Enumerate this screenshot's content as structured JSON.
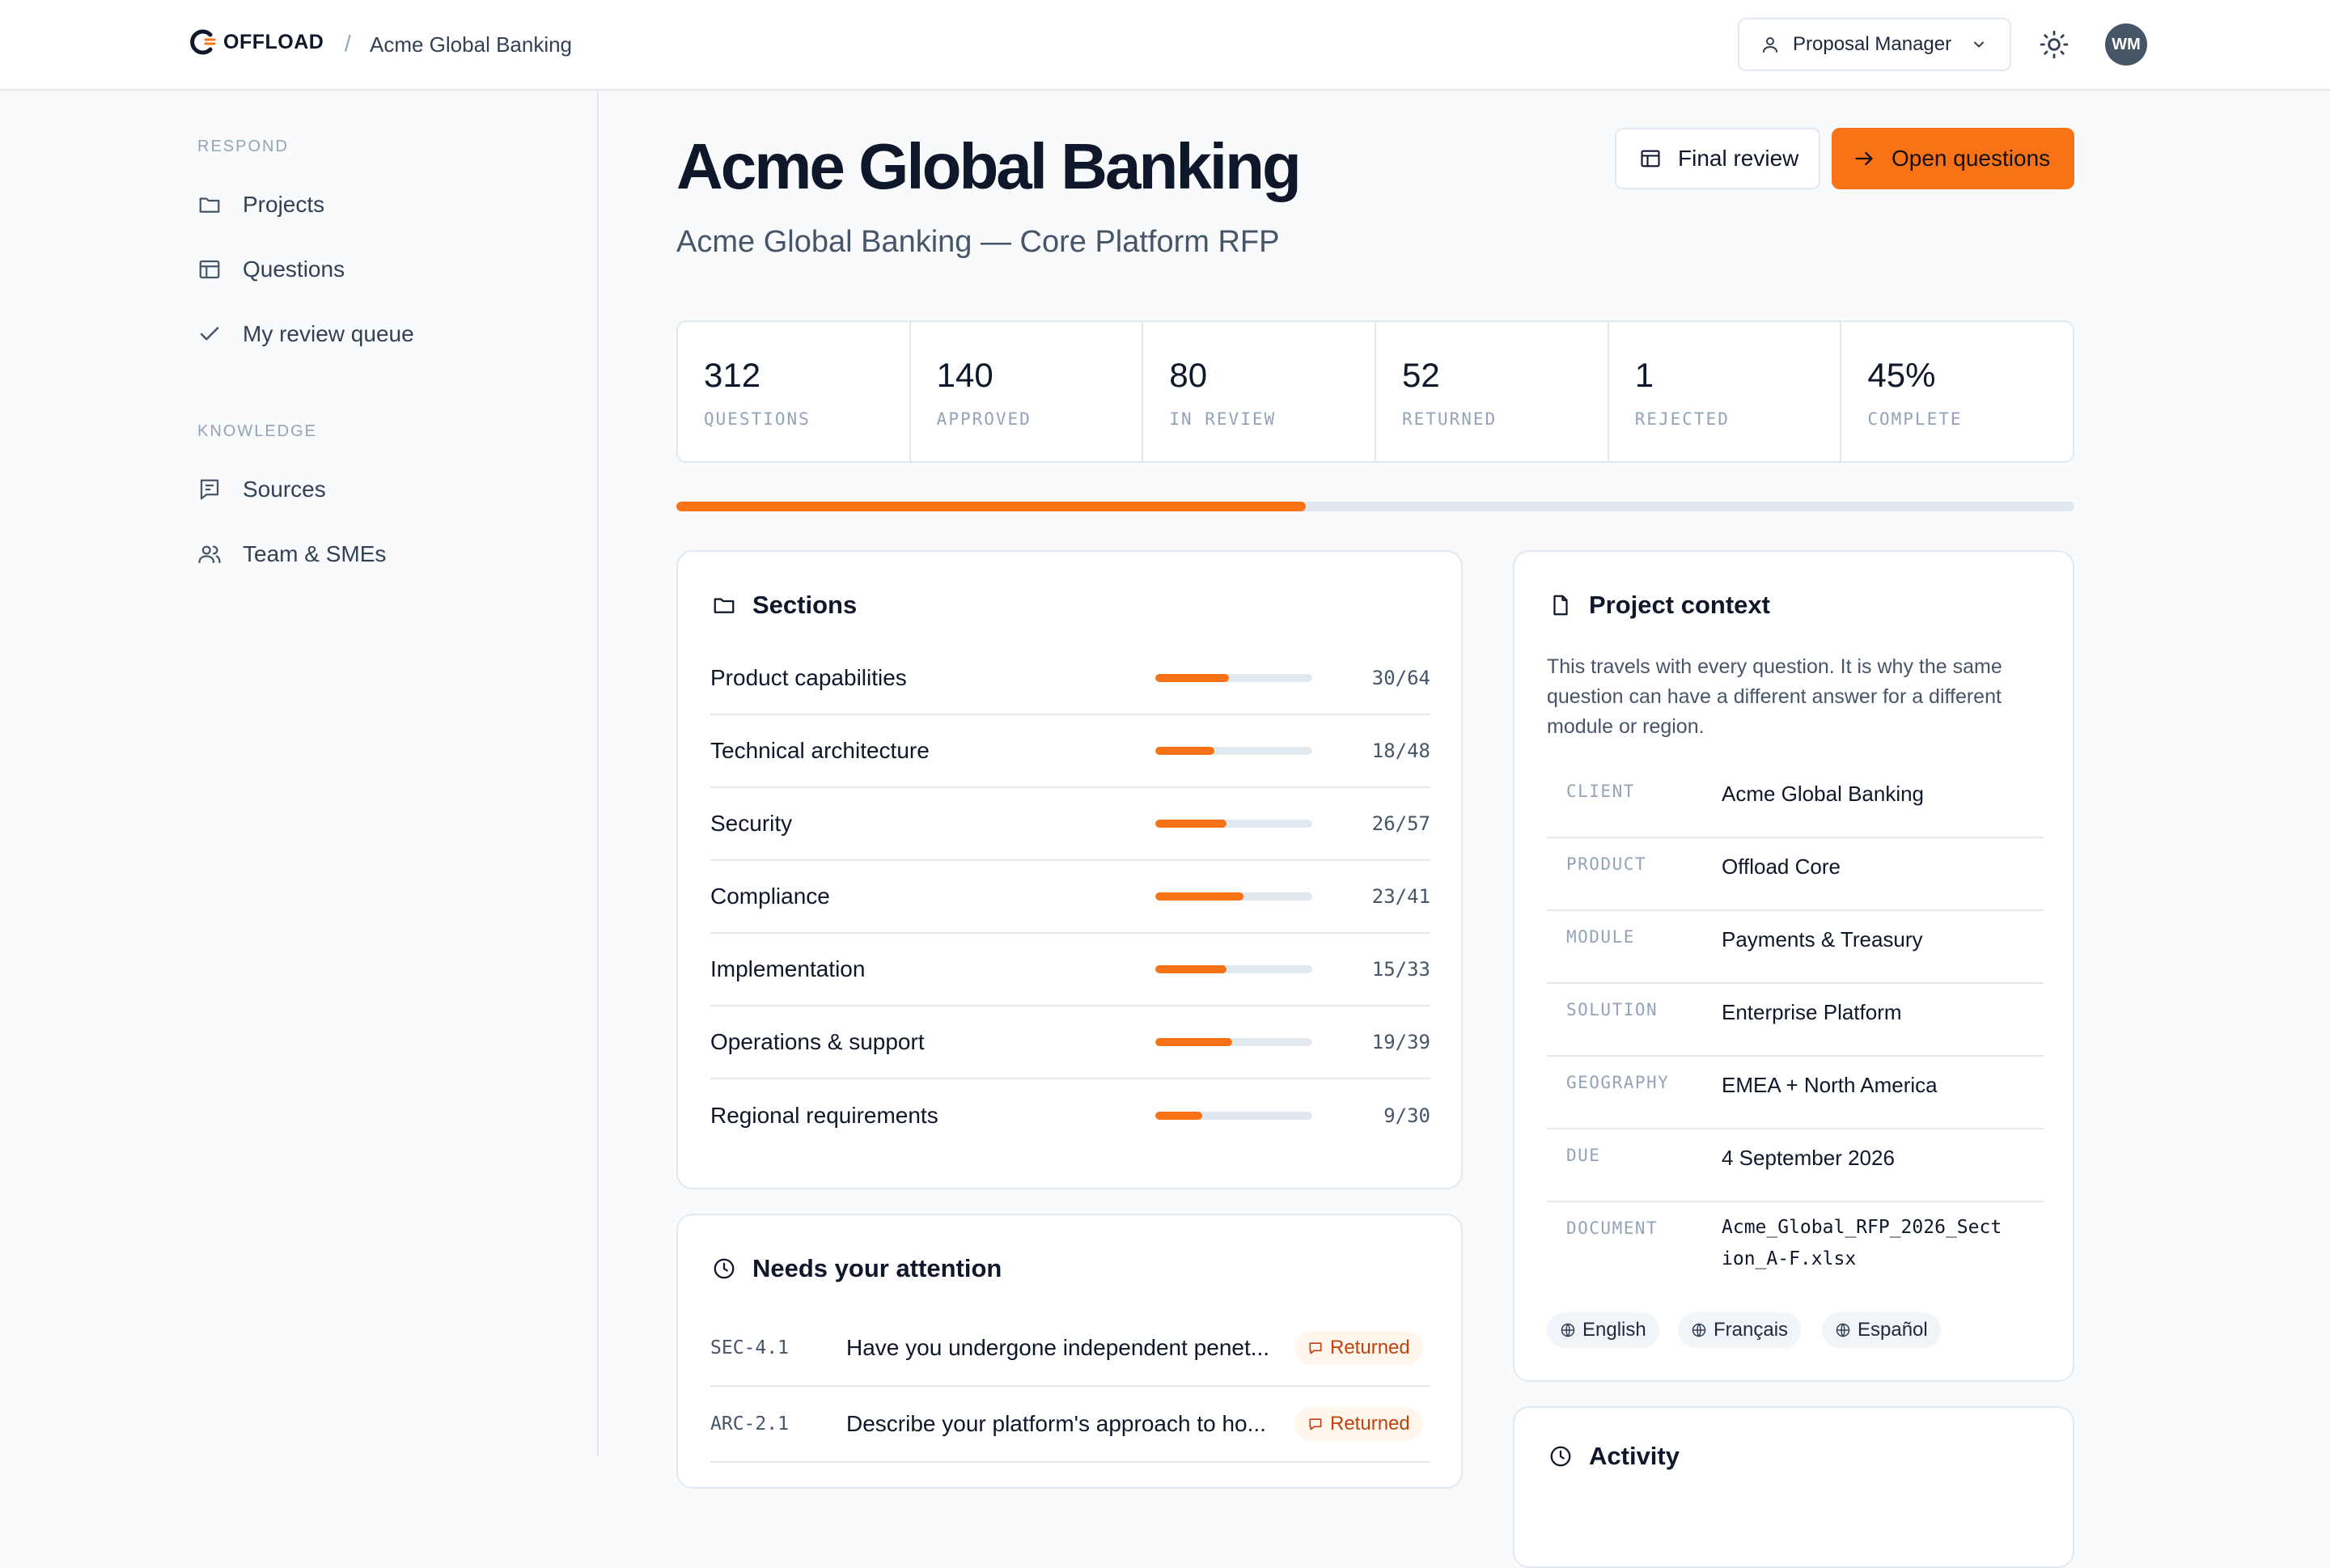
{
  "brand": {
    "name": "OFFLOAD",
    "accent": "#f97316"
  },
  "breadcrumb": {
    "current": "Acme Global Banking"
  },
  "header": {
    "role": "Proposal Manager",
    "avatar_initials": "WM"
  },
  "sidebar": {
    "groups": [
      {
        "label": "RESPOND",
        "items": [
          {
            "label": "Projects",
            "icon": "folder-icon"
          },
          {
            "label": "Questions",
            "icon": "table-icon"
          },
          {
            "label": "My review queue",
            "icon": "check-icon"
          }
        ]
      },
      {
        "label": "KNOWLEDGE",
        "items": [
          {
            "label": "Sources",
            "icon": "message-square-icon"
          },
          {
            "label": "Team & SMEs",
            "icon": "users-icon"
          }
        ]
      }
    ]
  },
  "page": {
    "title": "Acme Global Banking",
    "subtitle": "Acme Global Banking — Core Platform RFP",
    "final_review_label": "Final review",
    "open_questions_label": "Open questions"
  },
  "stats": [
    {
      "value": "312",
      "label": "QUESTIONS"
    },
    {
      "value": "140",
      "label": "APPROVED"
    },
    {
      "value": "80",
      "label": "IN REVIEW"
    },
    {
      "value": "52",
      "label": "RETURNED"
    },
    {
      "value": "1",
      "label": "REJECTED"
    },
    {
      "value": "45%",
      "label": "COMPLETE"
    }
  ],
  "progress": {
    "complete_fraction": 0.45
  },
  "sections": {
    "title": "Sections",
    "rows": [
      {
        "name": "Product capabilities",
        "count": "30/64",
        "done": 30,
        "total": 64
      },
      {
        "name": "Technical architecture",
        "count": "18/48",
        "done": 18,
        "total": 48
      },
      {
        "name": "Security",
        "count": "26/57",
        "done": 26,
        "total": 57
      },
      {
        "name": "Compliance",
        "count": "23/41",
        "done": 23,
        "total": 41
      },
      {
        "name": "Implementation",
        "count": "15/33",
        "done": 15,
        "total": 33
      },
      {
        "name": "Operations & support",
        "count": "19/39",
        "done": 19,
        "total": 39
      },
      {
        "name": "Regional requirements",
        "count": "9/30",
        "done": 9,
        "total": 30
      }
    ]
  },
  "attention": {
    "title": "Needs your attention",
    "rows": [
      {
        "id": "SEC-4.1",
        "question": "Have you undergone independent penet...",
        "status": "Returned"
      },
      {
        "id": "ARC-2.1",
        "question": "Describe your platform's approach to ho...",
        "status": "Returned"
      }
    ]
  },
  "context": {
    "title": "Project context",
    "description": "This travels with every question. It is why the same question can have a different answer for a different module or region.",
    "fields": [
      {
        "key": "CLIENT",
        "value": "Acme Global Banking"
      },
      {
        "key": "PRODUCT",
        "value": "Offload Core"
      },
      {
        "key": "MODULE",
        "value": "Payments & Treasury"
      },
      {
        "key": "SOLUTION",
        "value": "Enterprise Platform"
      },
      {
        "key": "GEOGRAPHY",
        "value": "EMEA + North America"
      },
      {
        "key": "DUE",
        "value": "4 September 2026"
      },
      {
        "key": "DOCUMENT",
        "value": "Acme_Global_RFP_2026_Section_A-F.xlsx"
      }
    ],
    "languages": [
      "English",
      "Français",
      "Español"
    ]
  },
  "activity": {
    "title": "Activity"
  }
}
